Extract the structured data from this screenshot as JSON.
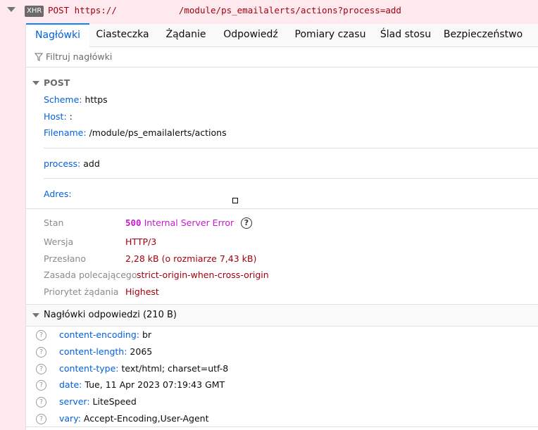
{
  "request": {
    "badge": "XHR",
    "method": "POST",
    "url_prefix": "https://",
    "url_suffix": "/module/ps_emailalerts/actions?process=add"
  },
  "tabs": [
    {
      "label": "Nagłówki",
      "active": true
    },
    {
      "label": "Ciasteczka"
    },
    {
      "label": "Żądanie"
    },
    {
      "label": "Odpowiedź"
    },
    {
      "label": "Pomiary czasu"
    },
    {
      "label": "Ślad stosu"
    },
    {
      "label": "Bezpieczeństwo"
    }
  ],
  "filter": {
    "placeholder": "Filtruj nagłówki"
  },
  "post_section": {
    "title": "POST",
    "scheme_key": "Scheme:",
    "scheme_value": "https",
    "host_key": "Host:",
    "host_value": ":",
    "filename_key": "Filename:",
    "filename_value": "/module/ps_emailalerts/actions",
    "process_key": "process:",
    "process_value": "add",
    "address_key": "Adres:"
  },
  "status": {
    "stan_key": "Stan",
    "code": "500",
    "text": "Internal Server Error",
    "help": "?",
    "version_key": "Wersja",
    "version_value": "HTTP/3",
    "transferred_key": "Przesłano",
    "transferred_value": "2,28 kB (o rozmiarze 7,43 kB)",
    "referrer_key": "Zasada polecającego",
    "referrer_value": "strict-origin-when-cross-origin",
    "priority_key": "Priorytet żądania",
    "priority_value": "Highest"
  },
  "response_headers": {
    "title": "Nagłówki odpowiedzi (210 B)",
    "items": [
      {
        "key": "content-encoding:",
        "value": "br"
      },
      {
        "key": "content-length:",
        "value": "2065"
      },
      {
        "key": "content-type:",
        "value": "text/html; charset=utf-8"
      },
      {
        "key": "date:",
        "value": "Tue, 11 Apr 2023 07:19:43 GMT"
      },
      {
        "key": "server:",
        "value": "LiteSpeed"
      },
      {
        "key": "vary:",
        "value": "Accept-Encoding,User-Agent"
      }
    ]
  },
  "colors": {
    "accent": "#0060df",
    "status_error": "#c519cd",
    "value_red": "#a4000f",
    "row_bg": "#fde9ee"
  }
}
